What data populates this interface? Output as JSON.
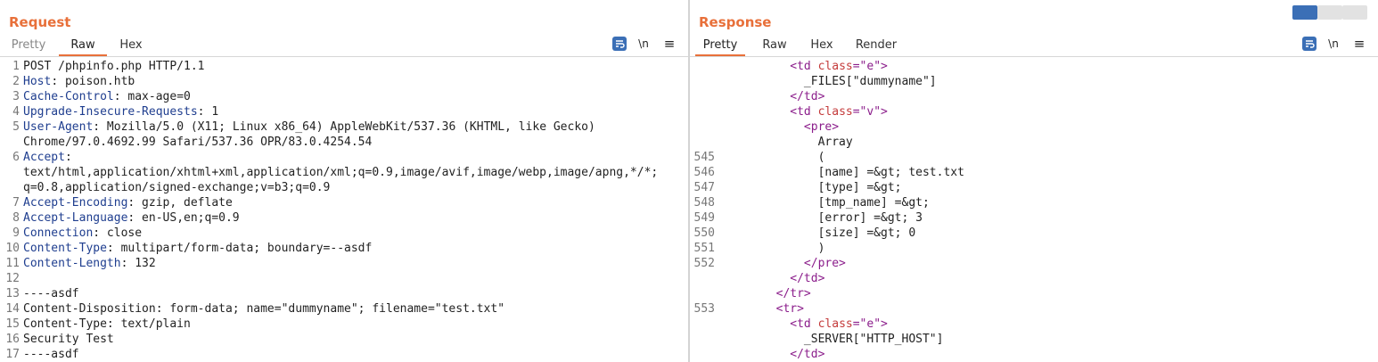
{
  "request": {
    "title": "Request",
    "tabs": [
      "Pretty",
      "Raw",
      "Hex"
    ],
    "active_tab": "Raw",
    "icons": [
      "wrap-lines-icon",
      "newline-icon",
      "menu-icon"
    ],
    "newline_label": "\\n",
    "menu_label": "≡",
    "lines": [
      {
        "num": "1",
        "key": "",
        "text": "POST /phpinfo.php HTTP/1.1"
      },
      {
        "num": "2",
        "key": "Host",
        "text": ": poison.htb"
      },
      {
        "num": "3",
        "key": "Cache-Control",
        "text": ": max-age=0"
      },
      {
        "num": "4",
        "key": "Upgrade-Insecure-Requests",
        "text": ": 1"
      },
      {
        "num": "5",
        "key": "User-Agent",
        "text": ": Mozilla/5.0 (X11; Linux x86_64) AppleWebKit/537.36 (KHTML, like Gecko)"
      },
      {
        "num": "",
        "key": "",
        "text": "Chrome/97.0.4692.99 Safari/537.36 OPR/83.0.4254.54"
      },
      {
        "num": "6",
        "key": "Accept",
        "text": ":"
      },
      {
        "num": "",
        "key": "",
        "text": "text/html,application/xhtml+xml,application/xml;q=0.9,image/avif,image/webp,image/apng,*/*;"
      },
      {
        "num": "",
        "key": "",
        "text": "q=0.8,application/signed-exchange;v=b3;q=0.9"
      },
      {
        "num": "7",
        "key": "Accept-Encoding",
        "text": ": gzip, deflate"
      },
      {
        "num": "8",
        "key": "Accept-Language",
        "text": ": en-US,en;q=0.9"
      },
      {
        "num": "9",
        "key": "Connection",
        "text": ": close"
      },
      {
        "num": "10",
        "key": "Content-Type",
        "text": ": multipart/form-data; boundary=--asdf"
      },
      {
        "num": "11",
        "key": "Content-Length",
        "text": ": 132"
      },
      {
        "num": "12",
        "key": "",
        "text": ""
      },
      {
        "num": "13",
        "key": "",
        "text": "----asdf"
      },
      {
        "num": "14",
        "key": "",
        "text": "Content-Disposition: form-data; name=\"dummyname\"; filename=\"test.txt\""
      },
      {
        "num": "15",
        "key": "",
        "text": "Content-Type: text/plain"
      },
      {
        "num": "16",
        "key": "",
        "text": "Security Test"
      },
      {
        "num": "17",
        "key": "",
        "text": "----asdf"
      }
    ]
  },
  "response": {
    "title": "Response",
    "tabs": [
      "Pretty",
      "Raw",
      "Hex",
      "Render"
    ],
    "active_tab": "Pretty",
    "newline_label": "\\n",
    "menu_label": "≡",
    "layout_toggles": [
      "side-by-side",
      "stacked",
      "single"
    ],
    "lines": [
      {
        "num": "",
        "parts": [
          {
            "t": "          "
          },
          {
            "t": "<td ",
            "c": "tagc"
          },
          {
            "t": "class",
            "c": "attr"
          },
          {
            "t": "=\"e\"",
            "c": "tagc"
          },
          {
            "t": ">",
            "c": "tagc"
          }
        ]
      },
      {
        "num": "",
        "parts": [
          {
            "t": "            _FILES[\"dummyname\"]"
          }
        ]
      },
      {
        "num": "",
        "parts": [
          {
            "t": "          "
          },
          {
            "t": "</td>",
            "c": "tagc"
          }
        ]
      },
      {
        "num": "",
        "parts": [
          {
            "t": "          "
          },
          {
            "t": "<td ",
            "c": "tagc"
          },
          {
            "t": "class",
            "c": "attr"
          },
          {
            "t": "=\"v\"",
            "c": "tagc"
          },
          {
            "t": ">",
            "c": "tagc"
          }
        ]
      },
      {
        "num": "",
        "parts": [
          {
            "t": "            "
          },
          {
            "t": "<pre>",
            "c": "tagc"
          }
        ]
      },
      {
        "num": "",
        "parts": [
          {
            "t": "              Array"
          }
        ]
      },
      {
        "num": "545",
        "parts": [
          {
            "t": "              ("
          }
        ]
      },
      {
        "num": "546",
        "parts": [
          {
            "t": "              [name] =&gt; test.txt"
          }
        ]
      },
      {
        "num": "547",
        "parts": [
          {
            "t": "              [type] =&gt;"
          }
        ]
      },
      {
        "num": "548",
        "parts": [
          {
            "t": "              [tmp_name] =&gt;"
          }
        ]
      },
      {
        "num": "549",
        "parts": [
          {
            "t": "              [error] =&gt; 3"
          }
        ]
      },
      {
        "num": "550",
        "parts": [
          {
            "t": "              [size] =&gt; 0"
          }
        ]
      },
      {
        "num": "551",
        "parts": [
          {
            "t": "              )"
          }
        ]
      },
      {
        "num": "552",
        "parts": [
          {
            "t": "            "
          },
          {
            "t": "</pre>",
            "c": "tagc"
          }
        ]
      },
      {
        "num": "",
        "parts": [
          {
            "t": "          "
          },
          {
            "t": "</td>",
            "c": "tagc"
          }
        ]
      },
      {
        "num": "",
        "parts": [
          {
            "t": "        "
          },
          {
            "t": "</tr>",
            "c": "tagc"
          }
        ]
      },
      {
        "num": "553",
        "parts": [
          {
            "t": "        "
          },
          {
            "t": "<tr>",
            "c": "tagc"
          }
        ]
      },
      {
        "num": "",
        "parts": [
          {
            "t": "          "
          },
          {
            "t": "<td ",
            "c": "tagc"
          },
          {
            "t": "class",
            "c": "attr"
          },
          {
            "t": "=\"e\"",
            "c": "tagc"
          },
          {
            "t": ">",
            "c": "tagc"
          }
        ]
      },
      {
        "num": "",
        "parts": [
          {
            "t": "            _SERVER[\"HTTP_HOST\"]"
          }
        ]
      },
      {
        "num": "",
        "parts": [
          {
            "t": "          "
          },
          {
            "t": "</td>",
            "c": "tagc"
          }
        ]
      }
    ]
  },
  "colors": {
    "accent": "#e8703a",
    "header_key": "#1f3e8f",
    "tag": "#8b1d8b",
    "attr": "#c43b3b",
    "toggle_on": "#3b6fb6"
  }
}
